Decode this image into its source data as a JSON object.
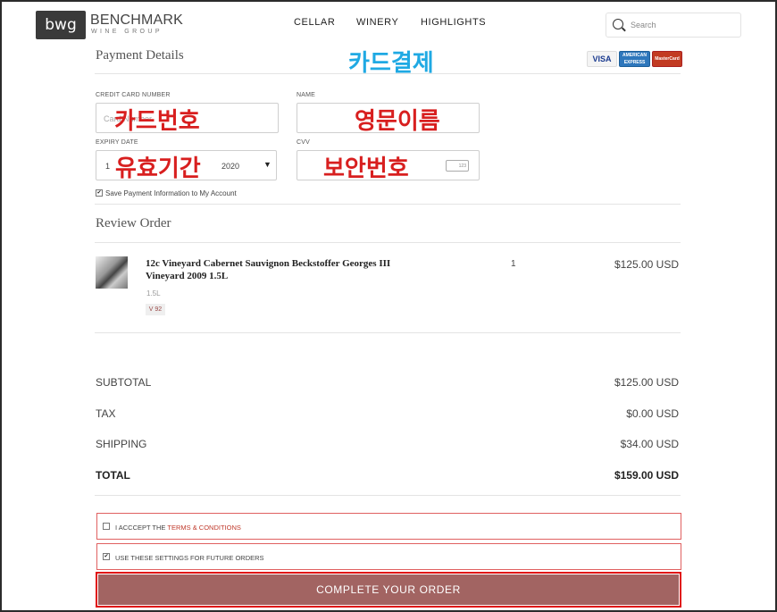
{
  "header": {
    "logo_text": "bwg",
    "brand_name": "BENCHMARK",
    "brand_sub": "WINE GROUP",
    "nav": [
      "CELLAR",
      "WINERY",
      "HIGHLIGHTS"
    ],
    "search_placeholder": "Search"
  },
  "payment": {
    "title": "Payment Details",
    "annotation": "카드결제",
    "card_icons": [
      "VISA",
      "AMERICAN EXPRESS",
      "MasterCard"
    ],
    "card_number_label": "CREDIT CARD NUMBER",
    "card_number_placeholder": "Card Number",
    "card_number_annotation": "카드번호",
    "name_label": "NAME",
    "name_annotation": "영문이름",
    "expiry_label": "EXPIRY DATE",
    "expiry_month": "1",
    "expiry_year": "2020",
    "expiry_annotation": "유효기간",
    "cvv_label": "CVV",
    "cvv_annotation": "보안번호",
    "cvv_icon_text": "123",
    "save_info_label": "Save Payment Information to My Account"
  },
  "review": {
    "title": "Review Order",
    "item": {
      "name_line1": "12c Vineyard Cabernet Sauvignon Beckstoffer Georges III",
      "name_line2": "Vineyard 2009 1.5L",
      "size": "1.5L",
      "rating": "V 92",
      "quantity": "1",
      "price": "$125.00 USD"
    }
  },
  "summary": {
    "subtotal_label": "SUBTOTAL",
    "subtotal": "$125.00 USD",
    "tax_label": "TAX",
    "tax": "$0.00 USD",
    "shipping_label": "SHIPPING",
    "shipping": "$34.00 USD",
    "total_label": "TOTAL",
    "total": "$159.00 USD"
  },
  "terms": {
    "accept_prefix": "I ACCCEPT THE ",
    "accept_link": "TERMS & CONDITIONS",
    "future_label": "USE THESE SETTINGS FOR FUTURE ORDERS"
  },
  "cta": {
    "label": "COMPLETE YOUR ORDER"
  },
  "colors": {
    "accent": "#a26462",
    "annotation_red": "#d81f1f",
    "annotation_cyan": "#1fa9e3",
    "terms_border": "#e06060"
  }
}
